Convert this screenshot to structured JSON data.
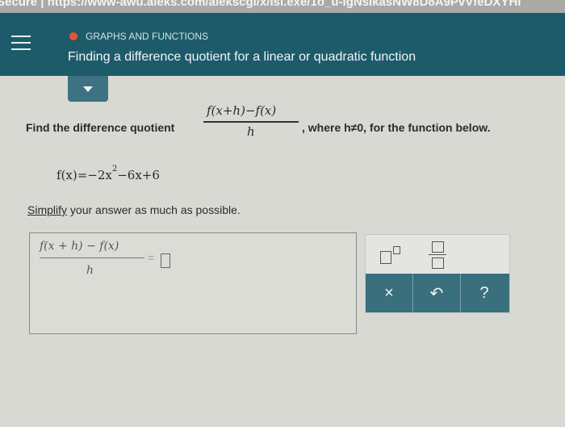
{
  "browser": {
    "url_fragment": "Secure | https://www-awu.aleks.com/alekscgi/x/Isl.exe/1o_u-IgNsIkasNW8D8A9PvVfeDXYHI"
  },
  "header": {
    "category": "GRAPHS AND FUNCTIONS",
    "title": "Finding a difference quotient for a linear or quadratic function"
  },
  "question": {
    "prefix": "Find the difference quotient",
    "frac_numerator": "f(x+h)−f(x)",
    "frac_denominator": "h",
    "suffix": ", where h≠0, for the function below.",
    "function_lhs": "f(x)=−2x",
    "function_exp": "2",
    "function_rhs": "−6x+6",
    "simplify_word": "Simplify",
    "simplify_rest": " your answer as much as possible."
  },
  "answer": {
    "numerator": "f(x + h) − f(x)",
    "denominator": "h",
    "equals": "="
  },
  "keypad": {
    "times": "×",
    "undo": "↶",
    "help": "?"
  },
  "colors": {
    "header_bg": "#1d5b6b",
    "dot": "#e8542f",
    "keypad_bar": "#3a6f7d"
  }
}
